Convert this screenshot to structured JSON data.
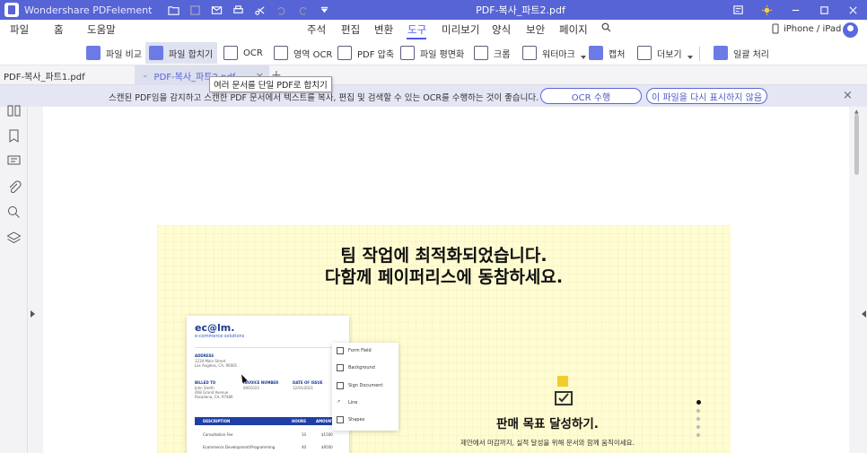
{
  "app": {
    "name": "Wondershare PDFelement",
    "document_title": "PDF-복사_파트2.pdf"
  },
  "menu": {
    "left": [
      "파일",
      "홈",
      "도움말"
    ],
    "main": [
      "주석",
      "편집",
      "변환",
      "도구",
      "미리보기",
      "양식",
      "보안",
      "페이지"
    ],
    "active": "도구",
    "device": "iPhone / iPad"
  },
  "toolbar": {
    "items": [
      {
        "label": "파일 비교",
        "icon": "compare-icon"
      },
      {
        "label": "파일 합치기",
        "icon": "combine-icon"
      },
      {
        "label": "OCR",
        "icon": "ocr-icon"
      },
      {
        "label": "영역 OCR",
        "icon": "area-ocr-icon"
      },
      {
        "label": "PDF 압축",
        "icon": "compress-icon"
      },
      {
        "label": "파일 평면화",
        "icon": "flatten-icon"
      },
      {
        "label": "크롭",
        "icon": "crop-icon"
      },
      {
        "label": "워터마크",
        "icon": "watermark-icon"
      },
      {
        "label": "캡처",
        "icon": "capture-icon"
      },
      {
        "label": "더보기",
        "icon": "more-icon"
      },
      {
        "label": "일괄 처리",
        "icon": "batch-icon"
      }
    ]
  },
  "tabs": [
    {
      "label": "PDF-복사_파트1.pdf"
    },
    {
      "label": "PDF-복사_파트2.pdf"
    }
  ],
  "tooltip": "여러 문서를 단일 PDF로 합치기",
  "banner": {
    "text": "스캔된 PDF임을 감지하고 스캔한 PDF 문서에서 텍스트를 복사, 편집 및 검색할 수 있는 OCR를 수행하는 것이 좋습니다.",
    "ocr_button": "OCR 수행",
    "dismiss_button": "이 파일을 다시 표시하지 않음"
  },
  "page": {
    "headline_1": "팀 작업에 최적화되었습니다.",
    "headline_2": "다함께 페이퍼리스에 동참하세요.",
    "invoice": {
      "logo": "ec@lm.",
      "logo_sub": "e-commerce solutions",
      "address_label": "ADDRESS",
      "address_lines": [
        "1234 Main Street",
        "Los Angeles, CA, 90001"
      ],
      "billed_label": "BILLED TO",
      "billed_lines": [
        "John Smith",
        "468 Grand Avenue",
        "Pasadena, CA, 97486"
      ],
      "invoice_label": "INVOICE NUMBER",
      "invoice_value": "0001023",
      "date_label": "DATE OF ISSUE",
      "date_value": "12/01/2021",
      "columns": [
        "DESCRIPTION",
        "HOURS",
        "AMOUNT"
      ],
      "rows": [
        {
          "desc": "Consultation Fee",
          "hours": "10",
          "amount": "$1500"
        },
        {
          "desc": "Ecommerce Development/Programming",
          "hours": "40",
          "amount": "$9500"
        }
      ]
    },
    "popmenu": [
      "Form Field",
      "Background",
      "Sign Document",
      "Line",
      "Shapes"
    ],
    "sales_title": "판매 목표 달성하기.",
    "sales_sub": "제안에서 마감까지, 실적 달성을 위해 문서와 함께 움직이세요."
  }
}
